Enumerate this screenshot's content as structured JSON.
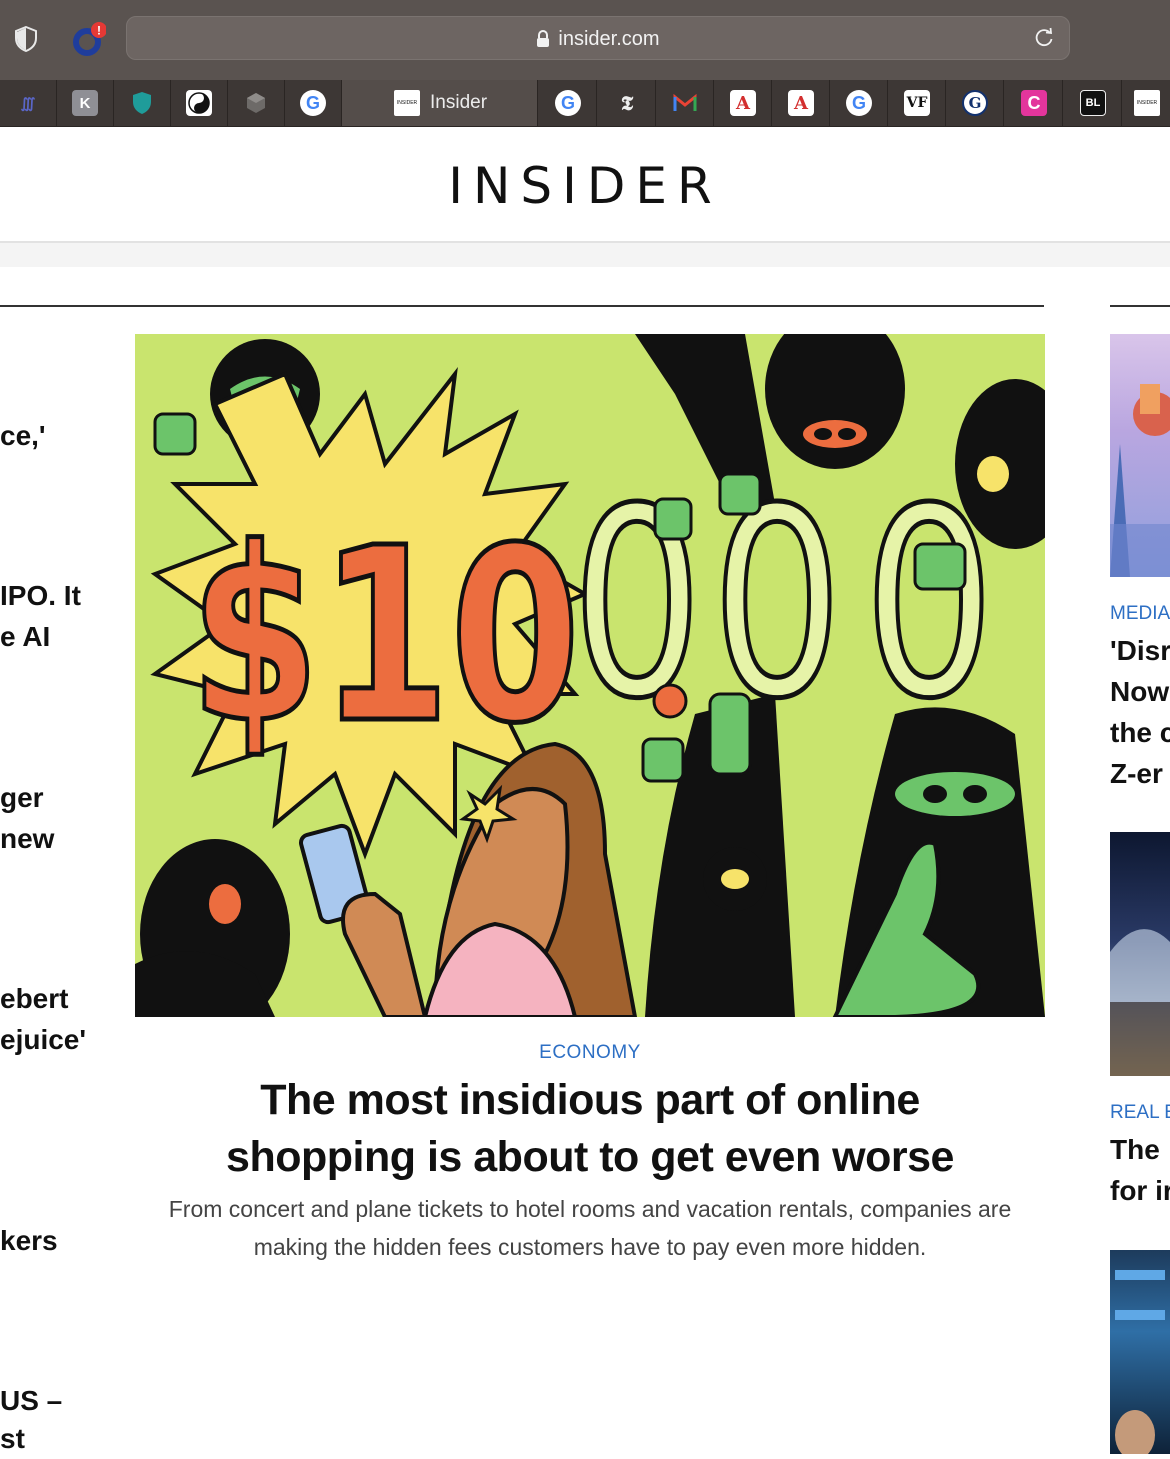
{
  "browser": {
    "url": "insider.com",
    "notification_badge": "!",
    "active_tab_label": "Insider",
    "tab_icons": [
      "wavy-logo-icon",
      "k-icon",
      "teal-shield-icon",
      "yin-yang-icon",
      "gray-cube-icon",
      "google-icon",
      "insider-icon",
      "google-icon",
      "nyt-icon",
      "gmail-icon",
      "a-icon",
      "a-icon",
      "google-icon",
      "vf-icon",
      "g-circle-icon",
      "c-icon",
      "bl-icon",
      "insider-icon"
    ]
  },
  "site": {
    "logo": "INSIDER"
  },
  "left_column": {
    "snippets": [
      "ce,'",
      "IPO. It",
      "e AI",
      "ger",
      "new",
      "ebert",
      "ejuice'",
      "kers",
      "US –",
      "st"
    ]
  },
  "hero": {
    "category": "ECONOMY",
    "headline_line1": "The most insidious part of online",
    "headline_line2": "shopping is about to get even worse",
    "dek": "From concert and plane tickets to hotel rooms and vacation rentals, companies are making the hidden fees customers have to pay even more hidden.",
    "illustration_text": {
      "price_prefix": "$10",
      "zeros": [
        "0",
        "0",
        "0"
      ]
    }
  },
  "right_column": {
    "stories": [
      {
        "category": "MEDIA",
        "lines": [
          "'Disr",
          "Now",
          "the c",
          "Z-er"
        ]
      },
      {
        "category": "REAL E",
        "lines": [
          "The",
          "for ir"
        ]
      }
    ]
  },
  "colors": {
    "chrome": "#5a5350",
    "tabbar": "#3d3735",
    "accent_blue": "#2d6fc4",
    "hero_bg": "#c9e46e",
    "burst_yellow": "#f7e36a",
    "price_orange": "#ec6d3f"
  }
}
